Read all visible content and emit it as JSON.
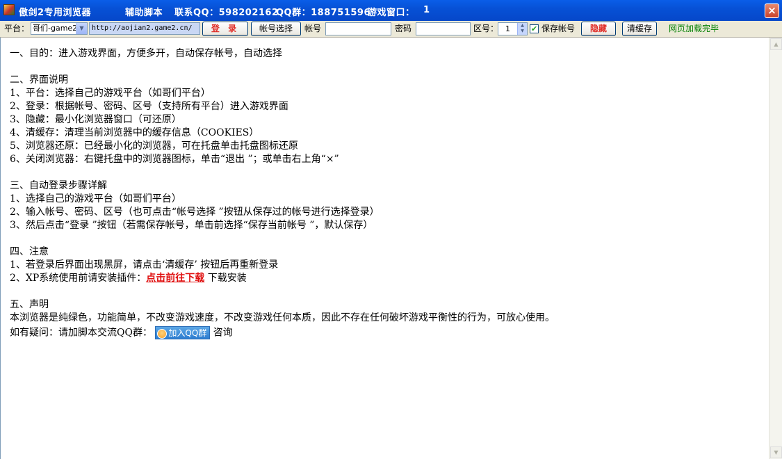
{
  "window": {
    "app_name": "傲剑2专用浏览器",
    "helper": "辅助脚本",
    "contact_qq": "联系QQ：598202162",
    "qq_group": "QQ群：188751596",
    "game_window": "游戏窗口：",
    "game_window_count": "1",
    "close_symbol": "×"
  },
  "toolbar": {
    "platform_label": "平台：",
    "platform_value": "哥们-game2",
    "url": "http://aojian2.game2.cn/",
    "login_button": "登 录",
    "account_select_button": "帐号选择",
    "account_label": "帐号",
    "account_value": "",
    "password_label": "密码",
    "password_value": "",
    "zone_label": "区号：",
    "zone_value": "1",
    "save_account_label": "保存帐号",
    "save_account_checked": true,
    "hide_button": "隐藏",
    "clear_cache_button": "清缓存",
    "status_text": "网页加载完毕"
  },
  "content": {
    "s1_title": "一、目的：进入游戏界面，方便多开，自动保存帐号，自动选择",
    "s2_title": "二、界面说明",
    "s2_items": [
      "1、平台：选择自己的游戏平台（如哥们平台）",
      "2、登录：根据帐号、密码、区号（支持所有平台）进入游戏界面",
      "3、隐藏：最小化浏览器窗口（可还原）",
      "4、清缓存：清理当前浏览器中的缓存信息（COOKIES）",
      "5、浏览器还原：已经最小化的浏览器，可在托盘单击托盘图标还原",
      "6、关闭浏览器：右键托盘中的浏览器图标，单击“退出 ”；或单击右上角“×”"
    ],
    "s3_title": "三、自动登录步骤详解",
    "s3_items": [
      "1、选择自己的游戏平台（如哥们平台）",
      "2、输入帐号、密码、区号（也可点击“帐号选择 ”按钮从保存过的帐号进行选择登录）",
      "3、然后点击“登录 ”按钮（若需保存帐号，单击前选择“保存当前帐号 ”，默认保存）"
    ],
    "s4_title": "四、注意",
    "s4_item1": "1、若登录后界面出现黑屏，请点击‘清缓存’ 按钮后再重新登录",
    "s4_item2_prefix": "2、XP系统使用前请安装插件：",
    "s4_item2_link": "点击前往下载",
    "s4_item2_suffix": " 下载安装",
    "s5_title": "五、声明",
    "s5_text": "本浏览器是纯绿色，功能简单，不改变游戏速度，不改变游戏任何本质，因此不存在任何破坏游戏平衡性的行为，可放心使用。",
    "qq_prefix": "如有疑问：请加脚本交流QQ群：",
    "qq_badge": "加入QQ群",
    "qq_suffix": " 咨询"
  },
  "icons": {
    "app": "app-icon",
    "close": "close-icon",
    "qq": "qq-penguin-icon",
    "scroll_up": "scroll-up-icon",
    "scroll_down": "scroll-down-icon"
  }
}
